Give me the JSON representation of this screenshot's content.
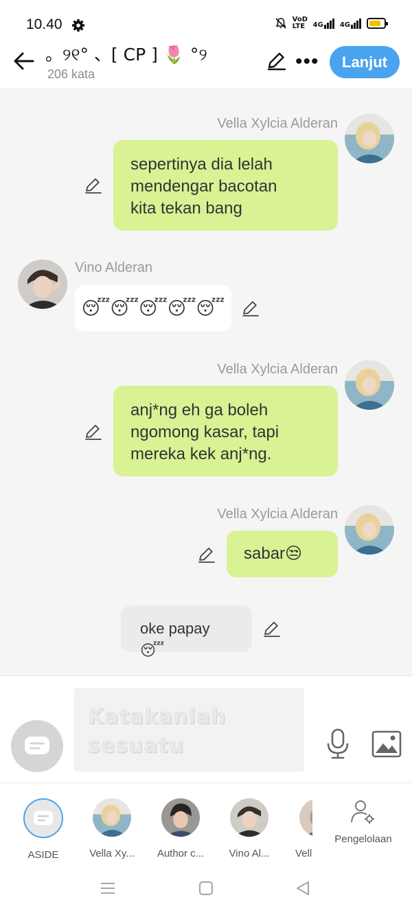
{
  "status_bar": {
    "time": "10.40",
    "icons": [
      "gear-icon",
      "mute-icon",
      "volte-icon",
      "signal-4g-icon",
      "signal-4g-icon",
      "battery-icon"
    ],
    "signal_labels": [
      "VoD LTE",
      "4G",
      "4G"
    ],
    "battery_level": 0.8,
    "battery_color": "#f2c200"
  },
  "header": {
    "title": "。୨୧° 、[ CP ] 🌷 °୨",
    "word_count": "206 kata",
    "next_label": "Lanjut",
    "more_label": "•••",
    "accent_color": "#4aa3ee"
  },
  "messages": [
    {
      "sender": "Vella Xylcia Alderan",
      "side": "right",
      "text": [
        "sepertinya dia lelah",
        "mendengar bacotan",
        "kita tekan bang"
      ],
      "bubble_color": "#d8f294"
    },
    {
      "sender": "Vino Alderan",
      "side": "left",
      "text": [
        "😴😴😴😴😴"
      ],
      "bubble_color": "#ffffff"
    },
    {
      "sender": "Vella Xylcia Alderan",
      "side": "right",
      "text": [
        "anj*ng eh ga boleh",
        "ngomong kasar, tapi",
        "mereka kek anj*ng."
      ],
      "bubble_color": "#d8f294"
    },
    {
      "sender": "Vella Xylcia Alderan",
      "side": "right",
      "text": [
        "sabar😒"
      ],
      "bubble_color": "#d8f294"
    },
    {
      "sender": "",
      "side": "narration",
      "text": [
        "oke papay😴"
      ],
      "bubble_color": "#ebebeb"
    }
  ],
  "composer": {
    "placeholder_lines": [
      "Katakanlah",
      "sesuatu"
    ]
  },
  "characters": [
    {
      "name": "ASIDE",
      "selected": true
    },
    {
      "name": "Vella Xy...",
      "selected": false
    },
    {
      "name": "Author c...",
      "selected": false
    },
    {
      "name": "Vino Al...",
      "selected": false
    },
    {
      "name": "Vell",
      "selected": false
    }
  ],
  "manage_label": "Pengelolaan"
}
